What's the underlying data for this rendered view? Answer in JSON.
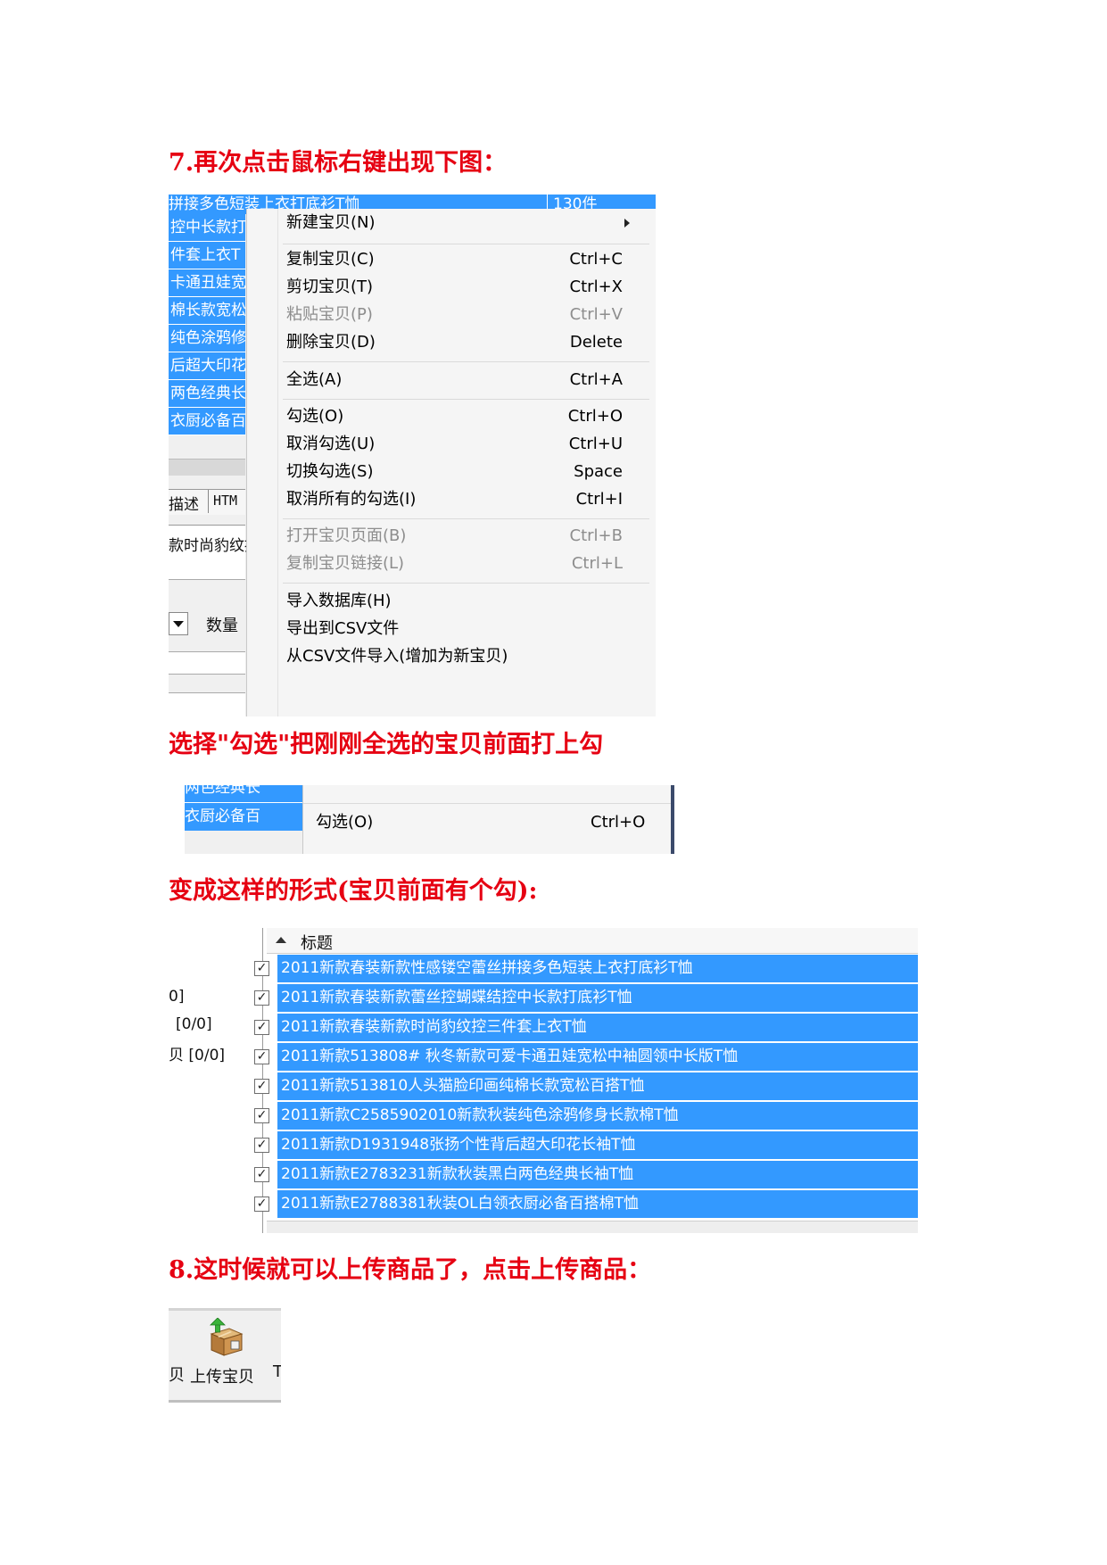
{
  "headings": {
    "h7": "7.再次点击鼠标右键出现下图：",
    "h_choose": "选择\"勾选\"把刚刚全选的宝贝前面打上勾",
    "h_result": "变成这样的形式(宝贝前面有个勾):",
    "h8": "8.这时候就可以上传商品了，点击上传商品："
  },
  "shot1": {
    "header_title": "拼接多色短装上衣打底衫T恤",
    "header_count": "130件",
    "bg_rows": [
      "控中长款打",
      "件套上衣T",
      "卡通丑娃宽",
      "棉长款宽松",
      "纯色涂鸦修",
      "后超大印花",
      "两色经典长",
      "衣厨必备百"
    ],
    "tab_desc": "描述",
    "tab_html": "HTM",
    "detail_text": "款时尚豹纹控",
    "qty_label": "数量",
    "menu": [
      {
        "label": "新建宝贝(N)",
        "shortcut": "",
        "submenu": true
      },
      {
        "label": "复制宝贝(C)",
        "shortcut": "Ctrl+C"
      },
      {
        "label": "剪切宝贝(T)",
        "shortcut": "Ctrl+X"
      },
      {
        "label": "粘贴宝贝(P)",
        "shortcut": "Ctrl+V",
        "disabled": true
      },
      {
        "label": "删除宝贝(D)",
        "shortcut": "Delete"
      },
      {
        "label": "全选(A)",
        "shortcut": "Ctrl+A"
      },
      {
        "label": "勾选(O)",
        "shortcut": "Ctrl+O"
      },
      {
        "label": "取消勾选(U)",
        "shortcut": "Ctrl+U"
      },
      {
        "label": "切换勾选(S)",
        "shortcut": "Space"
      },
      {
        "label": "取消所有的勾选(I)",
        "shortcut": "Ctrl+I"
      },
      {
        "label": "打开宝贝页面(B)",
        "shortcut": "Ctrl+B",
        "disabled": true
      },
      {
        "label": "复制宝贝链接(L)",
        "shortcut": "Ctrl+L",
        "disabled": true
      },
      {
        "label": "导入数据库(H)",
        "shortcut": ""
      },
      {
        "label": "导出到CSV文件",
        "shortcut": ""
      },
      {
        "label": "从CSV文件导入(增加为新宝贝)",
        "shortcut": ""
      }
    ]
  },
  "shot2": {
    "row1": "两色经典长",
    "row2": "衣厨必备百",
    "item_label": "勾选(O)",
    "item_shortcut": "Ctrl+O"
  },
  "shot3": {
    "column_header": "标题",
    "left_labels": [
      "0]",
      "[0/0]",
      "贝 [0/0]"
    ],
    "check_mark": "✓",
    "rows": [
      "2011新款春装新款性感镂空蕾丝拼接多色短装上衣打底衫T恤",
      "2011新款春装新款蕾丝控蝴蝶结控中长款打底衫T恤",
      "2011新款春装新款时尚豹纹控三件套上衣T恤",
      "2011新款513808# 秋冬新款可爱卡通丑娃宽松中袖圆领中长版T恤",
      "2011新款513810人头猫脸印画纯棉长款宽松百搭T恤",
      "2011新款C2585902010新款秋装纯色涂鸦修身长款棉T恤",
      "2011新款D1931948张扬个性背后超大印花长袖T恤",
      "2011新款E2783231新款秋装黑白两色经典长袖T恤",
      "2011新款E2788381秋装OL白领衣厨必备百搭棉T恤"
    ]
  },
  "shot4": {
    "button_label": "上传宝贝",
    "left_fragment": "贝",
    "right_fragment": "T"
  }
}
